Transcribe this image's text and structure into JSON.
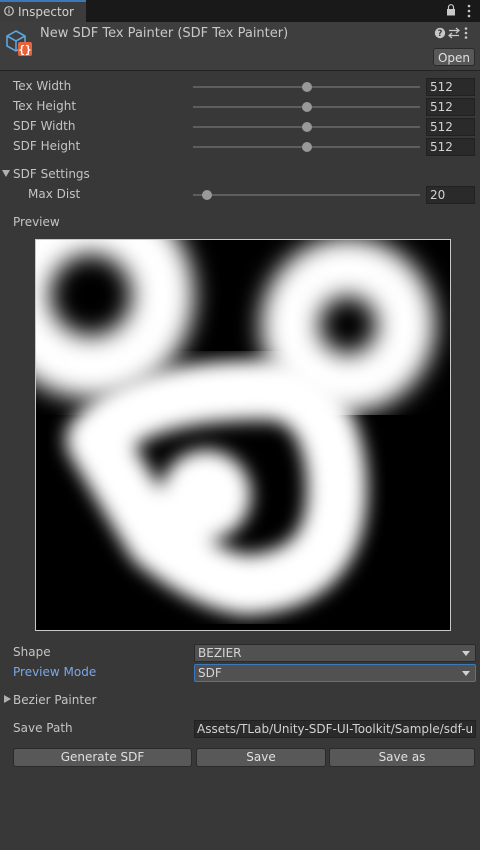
{
  "tab": {
    "label": "Inspector"
  },
  "header": {
    "title": "New SDF Tex Painter (SDF Tex Painter)",
    "open_label": "Open"
  },
  "sliders": [
    {
      "label": "Tex Width",
      "value": "512",
      "fraction": 0.5
    },
    {
      "label": "Tex Height",
      "value": "512",
      "fraction": 0.5
    },
    {
      "label": "SDF Width",
      "value": "512",
      "fraction": 0.5
    },
    {
      "label": "SDF Height",
      "value": "512",
      "fraction": 0.5
    }
  ],
  "sdf_settings": {
    "label": "SDF Settings",
    "max_dist": {
      "label": "Max Dist",
      "value": "20",
      "fraction": 0.05
    }
  },
  "preview": {
    "label": "Preview"
  },
  "shape": {
    "label": "Shape",
    "value": "BEZIER"
  },
  "preview_mode": {
    "label": "Preview Mode",
    "value": "SDF"
  },
  "bezier_painter": {
    "label": "Bezier Painter"
  },
  "save_path": {
    "label": "Save Path",
    "value": "Assets/TLab/Unity-SDF-UI-Toolkit/Sample/sdf-u"
  },
  "buttons": {
    "generate": "Generate SDF",
    "save": "Save",
    "save_as": "Save as"
  },
  "colors": {
    "accent": "#3a79bb",
    "link_label": "#7ba7e8",
    "background": "#383838"
  }
}
